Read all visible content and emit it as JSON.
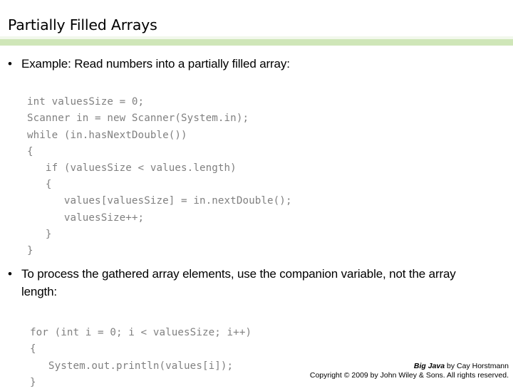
{
  "slide": {
    "title": "Partially Filled Arrays",
    "accent_color": "#cfe6b8",
    "code_color": "#808080",
    "background_color": "#ffffff"
  },
  "bullets": [
    {
      "marker": "•",
      "text": "Example: Read numbers into a partially filled array:"
    },
    {
      "marker": "•",
      "text": "To process the gathered array elements, use the companion variable, not the array length:"
    }
  ],
  "code_blocks": [
    {
      "id": "read-numbers-snippet",
      "text": "int valuesSize = 0;\nScanner in = new Scanner(System.in);\nwhile (in.hasNextDouble())\n{\n   if (valuesSize < values.length)\n   {\n      values[valuesSize] = in.nextDouble();\n      valuesSize++;\n   }\n}"
    },
    {
      "id": "process-elements-snippet",
      "text": "for (int i = 0; i < valuesSize; i++)\n{\n   System.out.println(values[i]);\n}"
    }
  ],
  "footer": {
    "book_title": "Big Java",
    "byline": " by Cay Horstmann",
    "copyright": "Copyright © 2009 by John Wiley & Sons.  All rights reserved."
  }
}
